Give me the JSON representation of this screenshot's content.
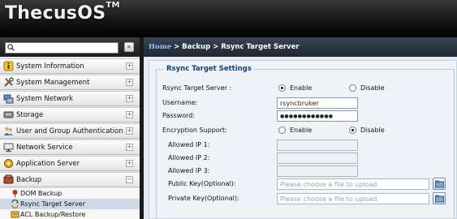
{
  "brand": {
    "name": "ThecusOS",
    "mark": "TM"
  },
  "sidebar": {
    "search": {
      "placeholder": "",
      "collapse_glyph": "«"
    },
    "items": [
      {
        "label": "System Information",
        "icon": "info-icon",
        "expand": "+"
      },
      {
        "label": "System Management",
        "icon": "tools-icon",
        "expand": "+"
      },
      {
        "label": "System Network",
        "icon": "network-icon",
        "expand": "+"
      },
      {
        "label": "Storage",
        "icon": "storage-icon",
        "expand": "+"
      },
      {
        "label": "User and Group Authentication",
        "icon": "users-icon",
        "expand": "+"
      },
      {
        "label": "Network Service",
        "icon": "network-service-icon",
        "expand": "+"
      },
      {
        "label": "Application Server",
        "icon": "application-icon",
        "expand": "+"
      },
      {
        "label": "Backup",
        "icon": "backup-icon",
        "expand": "−"
      }
    ],
    "backup_children": [
      {
        "label": "DOM Backup",
        "icon": "dom-backup-icon",
        "selected": false
      },
      {
        "label": "Rsync Target Server",
        "icon": "rsync-icon",
        "selected": true
      },
      {
        "label": "ACL Backup/Restore",
        "icon": "acl-backup-icon",
        "selected": false
      }
    ]
  },
  "breadcrumb": {
    "home": "Home",
    "sep1": " > ",
    "section": "Backup",
    "sep2": " > ",
    "page": "Rsync Target Server"
  },
  "form": {
    "legend": "Rsync Target Settings",
    "target_server": {
      "label": "Rsync Target Server :",
      "enable": "Enable",
      "disable": "Disable",
      "value": "Enable"
    },
    "username": {
      "label": "Username:",
      "value": "rsyncbruker"
    },
    "password": {
      "label": "Password:",
      "value": "●●●●●●●●●●●●"
    },
    "encryption": {
      "label": "Encryption Support:",
      "enable": "Enable",
      "disable": "Disable",
      "value": "Disable"
    },
    "allowed_ip1": {
      "label": "Allowed IP 1:",
      "value": ""
    },
    "allowed_ip2": {
      "label": "Allowed IP 2:",
      "value": ""
    },
    "allowed_ip3": {
      "label": "Allowed IP 3:",
      "value": ""
    },
    "public_key": {
      "label": "Public Key(Optional):",
      "placeholder": "Please choose a file to upload."
    },
    "private_key": {
      "label": "Private Key(Optional):",
      "placeholder": "Please choose a file to upload."
    }
  },
  "colors": {
    "accent": "#15406e",
    "home_link": "#8fc8ff",
    "selected_row": "#cfd9e6"
  }
}
